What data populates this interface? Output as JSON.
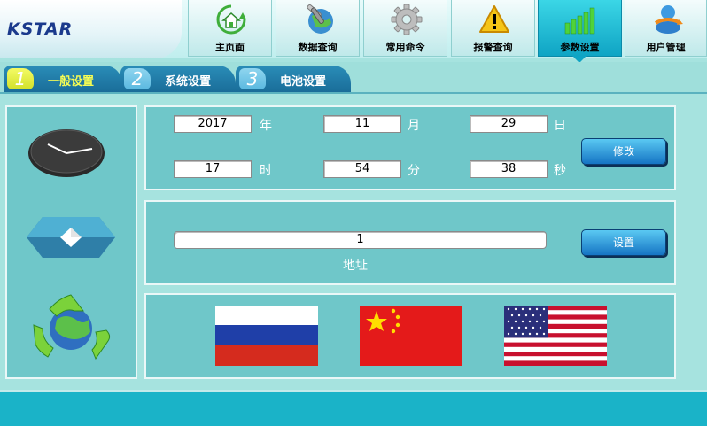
{
  "app": {
    "logo": "KSTAR"
  },
  "nav": [
    {
      "label": "主页面",
      "icon": "home-icon"
    },
    {
      "label": "数据查询",
      "icon": "globe-tools-icon"
    },
    {
      "label": "常用命令",
      "icon": "gear-icon"
    },
    {
      "label": "报警查询",
      "icon": "warning-icon"
    },
    {
      "label": "参数设置",
      "icon": "bars-icon",
      "active": true
    },
    {
      "label": "用户管理",
      "icon": "users-icon"
    }
  ],
  "tabs": [
    {
      "num": "1",
      "label": "一般设置",
      "active": true
    },
    {
      "num": "2",
      "label": "系统设置"
    },
    {
      "num": "3",
      "label": "电池设置"
    }
  ],
  "datetime": {
    "year": "2017",
    "year_unit": "年",
    "month": "11",
    "month_unit": "月",
    "day": "29",
    "day_unit": "日",
    "hour": "17",
    "hour_unit": "时",
    "minute": "54",
    "minute_unit": "分",
    "second": "38",
    "second_unit": "秒",
    "modify_label": "修改"
  },
  "address": {
    "value": "1",
    "label": "地址",
    "set_label": "设置"
  },
  "languages": [
    "russian-flag",
    "china-flag",
    "usa-flag"
  ],
  "colors": {
    "accent": "#1ab3c8",
    "panel": "#6fc7c9",
    "tab": "#1a6d99",
    "active_tab_text": "#f6fd53"
  }
}
